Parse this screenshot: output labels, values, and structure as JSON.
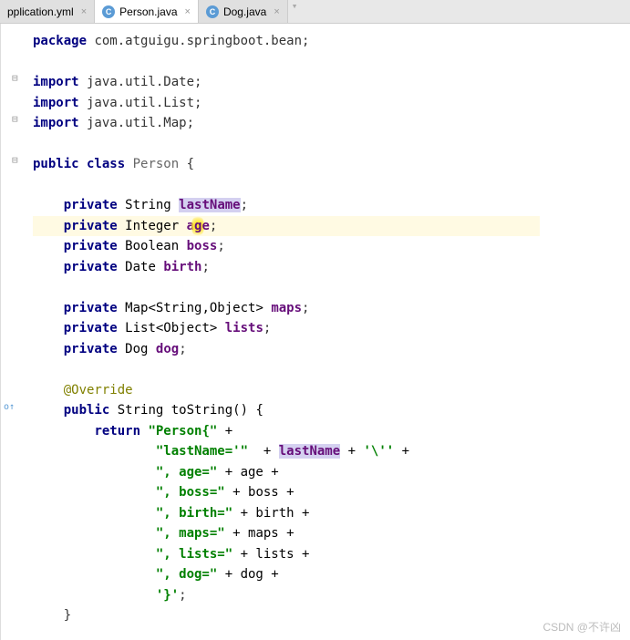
{
  "tabs": [
    {
      "label": "pplication.yml",
      "hasClose": true
    },
    {
      "label": "Person.java",
      "hasClose": true
    },
    {
      "label": "Dog.java",
      "hasClose": true
    }
  ],
  "code": {
    "packageKw": "package",
    "packageName": " com.atguigu.springboot.bean;",
    "importKw": "import",
    "imp1": " java.util.Date;",
    "imp2": " java.util.List;",
    "imp3": " java.util.Map;",
    "publicKw": "public",
    "classKw": " class ",
    "className": "Person",
    "openBrace": " {",
    "privateKw": "private",
    "stringType": " String ",
    "integerType": " Integer ",
    "booleanType": " Boolean ",
    "dateType": " Date ",
    "mapType": " Map<String,Object> ",
    "listType": " List<Object> ",
    "dogType": " Dog ",
    "lastNameField": "lastName",
    "ageFieldPre": "a",
    "ageFieldMid": "g",
    "ageFieldPost": "e",
    "bossField": "boss",
    "birthField": "birth",
    "mapsField": "maps",
    "listsField": "lists",
    "dogField": "dog",
    "semi": ";",
    "override": "@Override",
    "toStringSig": " String toString() {",
    "returnKw": "return",
    "strPerson": " \"Person{\" ",
    "plus": "+",
    "strLastName": "\"lastName='\" ",
    "plusSp": " + ",
    "escQuote": "'\\''",
    "strAge": "\", age=\" ",
    "plusAge": "+ age +",
    "strBoss": "\", boss=\" ",
    "plusBoss": "+ boss +",
    "strBirth": "\", birth=\" ",
    "plusBirth": "+ birth +",
    "strMaps": "\", maps=\" ",
    "plusMaps": "+ maps +",
    "strLists": "\", lists=\" ",
    "plusLists": "+ lists +",
    "strDog": "\", dog=\" ",
    "plusDog": "+ dog +",
    "strEnd": "'}'",
    "endSemi": ";",
    "closeBrace": "}"
  },
  "gutter": {
    "collapse1": "⊟",
    "collapse2": "⊟",
    "collapse3": "⊟",
    "override": "o↑"
  },
  "watermark": "CSDN @不许凶"
}
